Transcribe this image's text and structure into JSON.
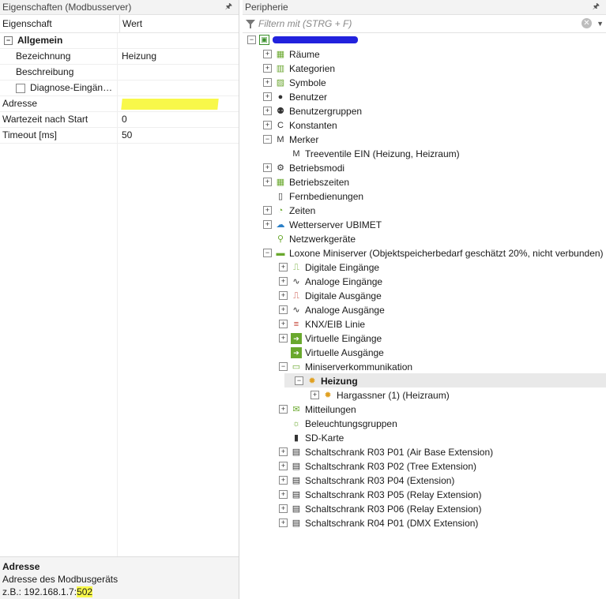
{
  "left_panel": {
    "title": "Eigenschaften (Modbusserver)",
    "pin": "📌",
    "columns": {
      "key": "Eigenschaft",
      "value": "Wert"
    },
    "group": {
      "label": "Allgemein",
      "toggle": "−"
    },
    "rows": [
      {
        "key": "Bezeichnung",
        "value": "Heizung"
      },
      {
        "key": "Beschreibung",
        "value": ""
      },
      {
        "key": "Diagnose-Eingän…",
        "value": ""
      },
      {
        "key": "Adresse",
        "value": ""
      },
      {
        "key": "Wartezeit nach Start",
        "value": "0"
      },
      {
        "key": "Timeout [ms]",
        "value": "50"
      }
    ],
    "description": {
      "title": "Adresse",
      "line1": "Adresse des Modbusgeräts",
      "line2_prefix": "z.B.: 192.168.1.7:",
      "line2_port": "502"
    }
  },
  "right_panel": {
    "title": "Peripherie",
    "pin": "📌",
    "filter_placeholder": "Filtern mit (STRG + F)",
    "tree": [
      {
        "level": 0,
        "exp": "−",
        "icon": "project-icon",
        "label": "",
        "redacted": true
      },
      {
        "level": 1,
        "exp": "+",
        "icon": "rooms-icon",
        "label": "Räume"
      },
      {
        "level": 1,
        "exp": "+",
        "icon": "categories-icon",
        "label": "Kategorien"
      },
      {
        "level": 1,
        "exp": "+",
        "icon": "symbols-icon",
        "label": "Symbole"
      },
      {
        "level": 1,
        "exp": "+",
        "icon": "user-icon",
        "label": "Benutzer"
      },
      {
        "level": 1,
        "exp": "+",
        "icon": "user-group-icon",
        "label": "Benutzergruppen"
      },
      {
        "level": 1,
        "exp": "+",
        "icon": "constants-icon",
        "label": "Konstanten"
      },
      {
        "level": 1,
        "exp": "−",
        "icon": "flag-icon",
        "label": "Merker"
      },
      {
        "level": 2,
        "exp": "",
        "icon": "flag-icon",
        "label": "Treeventile EIN (Heizung, Heizraum)"
      },
      {
        "level": 1,
        "exp": "+",
        "icon": "gear-icon",
        "label": "Betriebsmodi"
      },
      {
        "level": 1,
        "exp": "+",
        "icon": "calendar-icon",
        "label": "Betriebszeiten"
      },
      {
        "level": 1,
        "exp": "",
        "icon": "remote-icon",
        "label": "Fernbedienungen"
      },
      {
        "level": 1,
        "exp": "+",
        "icon": "clock-icon",
        "label": "Zeiten"
      },
      {
        "level": 1,
        "exp": "+",
        "icon": "weather-icon",
        "label": "Wetterserver UBIMET"
      },
      {
        "level": 1,
        "exp": "",
        "icon": "network-icon",
        "label": "Netzwerkgeräte"
      },
      {
        "level": 1,
        "exp": "−",
        "icon": "miniserver-icon",
        "label": "Loxone Miniserver (Objektspeicherbedarf geschätzt 20%, nicht verbunden)"
      },
      {
        "level": 2,
        "exp": "+",
        "icon": "digital-input-icon",
        "label": "Digitale Eingänge"
      },
      {
        "level": 2,
        "exp": "+",
        "icon": "analog-input-icon",
        "label": "Analoge Eingänge"
      },
      {
        "level": 2,
        "exp": "+",
        "icon": "digital-output-icon",
        "label": "Digitale Ausgänge"
      },
      {
        "level": 2,
        "exp": "+",
        "icon": "analog-output-icon",
        "label": "Analoge Ausgänge"
      },
      {
        "level": 2,
        "exp": "+",
        "icon": "knx-icon",
        "label": "KNX/EIB Linie"
      },
      {
        "level": 2,
        "exp": "+",
        "icon": "virtual-input-icon",
        "label": "Virtuelle Eingänge"
      },
      {
        "level": 2,
        "exp": "",
        "icon": "virtual-output-icon",
        "label": "Virtuelle Ausgänge"
      },
      {
        "level": 2,
        "exp": "−",
        "icon": "monitor-icon",
        "label": "Miniserverkommunikation"
      },
      {
        "level": 3,
        "exp": "−",
        "icon": "sun-icon",
        "label": "Heizung",
        "bold": true
      },
      {
        "level": 4,
        "exp": "+",
        "icon": "sun-icon",
        "label": "Hargassner (1) (Heizraum)"
      },
      {
        "level": 2,
        "exp": "+",
        "icon": "messages-icon",
        "label": "Mitteilungen"
      },
      {
        "level": 2,
        "exp": "",
        "icon": "lighting-icon",
        "label": "Beleuchtungsgruppen"
      },
      {
        "level": 2,
        "exp": "",
        "icon": "sd-card-icon",
        "label": "SD-Karte"
      },
      {
        "level": 2,
        "exp": "+",
        "icon": "extension-icon",
        "label": "Schaltschrank R03 P01 (Air Base Extension)"
      },
      {
        "level": 2,
        "exp": "+",
        "icon": "extension-icon",
        "label": "Schaltschrank R03 P02 (Tree Extension)"
      },
      {
        "level": 2,
        "exp": "+",
        "icon": "extension-icon",
        "label": "Schaltschrank R03 P04 (Extension)"
      },
      {
        "level": 2,
        "exp": "+",
        "icon": "extension-icon",
        "label": "Schaltschrank R03 P05 (Relay Extension)"
      },
      {
        "level": 2,
        "exp": "+",
        "icon": "extension-icon",
        "label": "Schaltschrank R03 P06 (Relay Extension)"
      },
      {
        "level": 2,
        "exp": "+",
        "icon": "extension-icon",
        "label": "Schaltschrank R04 P01 (DMX Extension)"
      }
    ]
  }
}
